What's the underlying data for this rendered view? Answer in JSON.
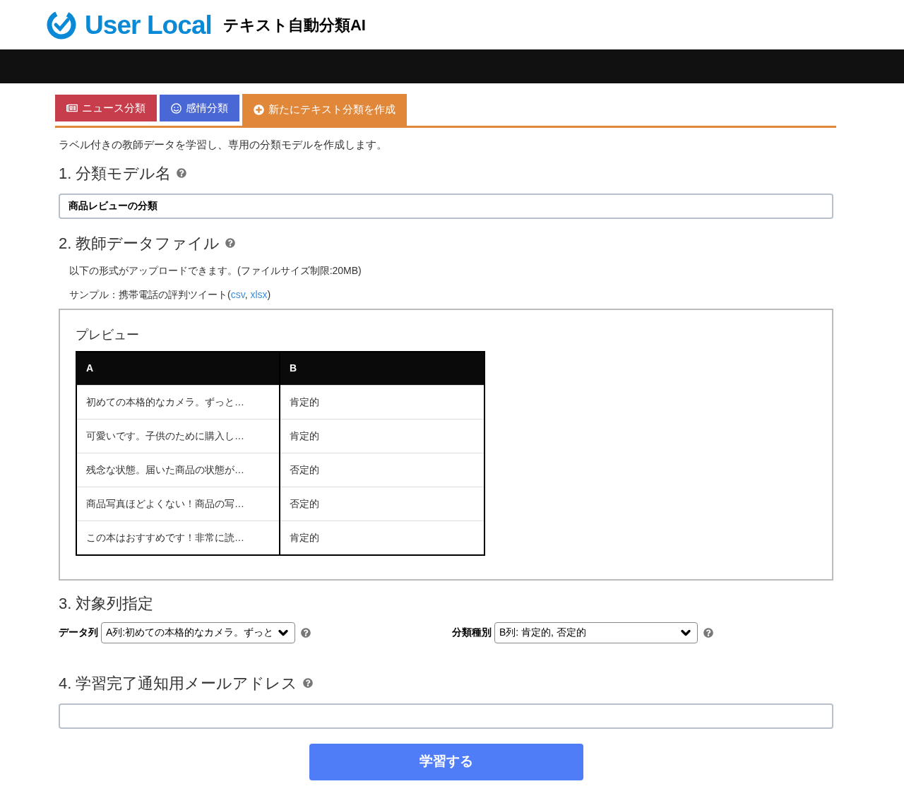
{
  "header": {
    "logo": "User Local",
    "product": "テキスト自動分類AI"
  },
  "tabs": [
    {
      "label": "ニュース分類",
      "kind": "news",
      "color": "#c83d4b",
      "selected": false
    },
    {
      "label": "感情分類",
      "kind": "emotion",
      "color": "#4a67d6",
      "selected": false
    },
    {
      "label": "新たにテキスト分類を作成",
      "kind": "create",
      "color": "#e0873a",
      "selected": true
    }
  ],
  "intro": "ラベル付きの教師データを学習し、専用の分類モデルを作成します。",
  "section1": {
    "title": "1. 分類モデル名",
    "value": "商品レビューの分類"
  },
  "section2": {
    "title": "2. 教師データファイル",
    "note": "以下の形式がアップロードできます。(ファイルサイズ制限:20MB)",
    "sample": {
      "prefix": "サンプル：携帯電話の評判ツイート(",
      "links": [
        "csv",
        "xlsx"
      ],
      "separator": ", ",
      "suffix": ")"
    },
    "preview": {
      "title": "プレビュー",
      "columns": [
        "A",
        "B"
      ],
      "rows": [
        [
          "初めての本格的なカメラ。ずっと…",
          "肯定的"
        ],
        [
          "可愛いです。子供のために購入し…",
          "肯定的"
        ],
        [
          "残念な状態。届いた商品の状態が…",
          "否定的"
        ],
        [
          "商品写真ほどよくない！商品の写…",
          "否定的"
        ],
        [
          "この本はおすすめです！非常に読…",
          "肯定的"
        ]
      ]
    }
  },
  "section3": {
    "title": "3. 対象列指定",
    "data_label": "データ列",
    "data_value": "A列:初めての本格的なカメラ。ずっと",
    "class_label": "分類種別",
    "class_value": "B列: 肯定的, 否定的"
  },
  "section4": {
    "title": "4. 学習完了通知用メールアドレス"
  },
  "submit": "学習する"
}
